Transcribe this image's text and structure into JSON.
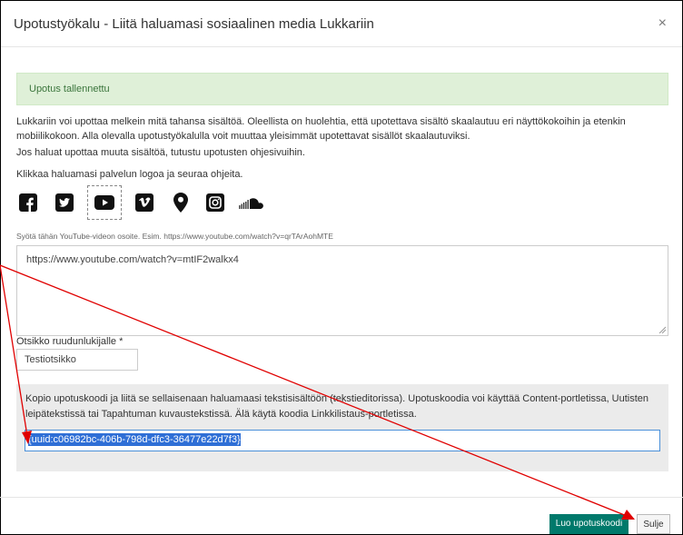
{
  "dialog": {
    "title": "Upotustyökalu - Liitä haluamasi sosiaalinen media Lukkariin",
    "close_symbol": "×"
  },
  "alert": {
    "text": "Upotus tallennettu"
  },
  "intro": {
    "paragraph1": "Lukkariin voi upottaa melkein mitä tahansa sisältöä. Oleellista on huolehtia, että upotettava sisältö skaalautuu eri näyttökokoihin ja etenkin mobiilikokoon. Alla olevalla upotustyökalulla voit muuttaa yleisimmät upotettavat sisällöt skaalautuviksi.",
    "paragraph2": "Jos haluat upottaa muuta sisältöä, tutustu upotusten ohjesivuihin.",
    "paragraph3": "Klikkaa haluamasi palvelun logoa ja seuraa ohjeita."
  },
  "services": [
    {
      "icon": "facebook-icon",
      "selected": false
    },
    {
      "icon": "twitter-icon",
      "selected": false
    },
    {
      "icon": "youtube-icon",
      "selected": true
    },
    {
      "icon": "vimeo-icon",
      "selected": false
    },
    {
      "icon": "map-pin-icon",
      "selected": false
    },
    {
      "icon": "instagram-icon",
      "selected": false
    },
    {
      "icon": "soundcloud-icon",
      "selected": false
    }
  ],
  "url_field": {
    "hint": "Syötä tähän YouTube-videon osoite. Esim. https://www.youtube.com/watch?v=qrTArAohMTE",
    "value": "https://www.youtube.com/watch?v=mtIF2walkx4"
  },
  "title_field": {
    "label": "Otsikko ruudunlukijalle *",
    "value": "Testiotsikko"
  },
  "code_panel": {
    "instructions": "Kopio upotuskoodi ja liitä se sellaisenaan haluamaasi tekstisisältöön (tekstieditorissa). Upotuskoodia voi käyttää Content-portletissa, Uutisten leipätekstissä tai Tapahtuman kuvaustekstissä. Älä käytä koodia Linkkilistaus-portletissa.",
    "code": "{uuid:c06982bc-406b-798d-dfc3-36477e22d7f3}"
  },
  "buttons": {
    "create_label": "Luo upotuskoodi",
    "close_label": "Sulje"
  },
  "colors": {
    "primary": "#00796b",
    "alert_bg": "#dff0d8",
    "alert_text": "#3c763d",
    "annotation": "#e00000"
  }
}
